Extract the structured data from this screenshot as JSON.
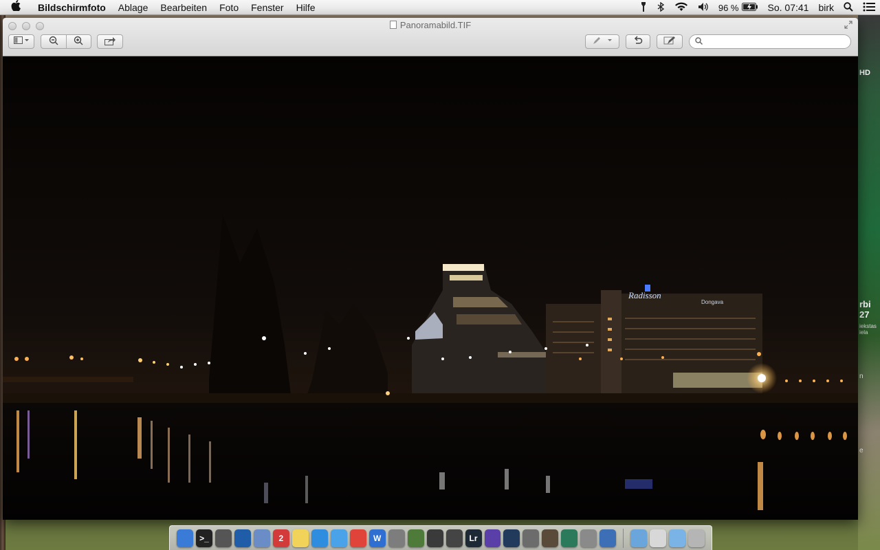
{
  "menubar": {
    "apple_icon": "apple-icon",
    "app_name": "Bildschirmfoto",
    "menus": [
      "Ablage",
      "Bearbeiten",
      "Foto",
      "Fenster",
      "Hilfe"
    ],
    "status": {
      "battery_percent": "96 %",
      "clock": "So. 07:41",
      "user": "birk"
    }
  },
  "window": {
    "title": "Panoramabild.TIF",
    "search": {
      "placeholder": "",
      "value": ""
    }
  },
  "desktop": {
    "hd_label": "HD",
    "poster_text": "rbi 27",
    "poster_sub": "iekstas iela",
    "side_n": "n",
    "side_e": "e"
  },
  "photo": {
    "hotel_sign": "Radisson",
    "building_sign": "Dongava"
  },
  "dock": {
    "items": [
      {
        "name": "finder",
        "label": "",
        "color": "#3b7bd8"
      },
      {
        "name": "terminal",
        "label": ">_",
        "color": "#222222"
      },
      {
        "name": "activity-monitor",
        "label": "",
        "color": "#555555"
      },
      {
        "name": "network",
        "label": "",
        "color": "#1f5da8"
      },
      {
        "name": "preview",
        "label": "",
        "color": "#6a8cc7"
      },
      {
        "name": "calendar",
        "label": "2",
        "color": "#d33a3a"
      },
      {
        "name": "notes",
        "label": "",
        "color": "#f2d35a"
      },
      {
        "name": "itunes",
        "label": "",
        "color": "#2f8de0"
      },
      {
        "name": "safari",
        "label": "",
        "color": "#4aa3e8"
      },
      {
        "name": "chrome",
        "label": "",
        "color": "#e0433a"
      },
      {
        "name": "word",
        "label": "W",
        "color": "#2e6fd1"
      },
      {
        "name": "camera",
        "label": "",
        "color": "#7d7d7d"
      },
      {
        "name": "photo-booth",
        "label": "",
        "color": "#4e7a3a"
      },
      {
        "name": "image-capture",
        "label": "",
        "color": "#3a3a3a"
      },
      {
        "name": "nikon",
        "label": "",
        "color": "#444444"
      },
      {
        "name": "lightroom",
        "label": "Lr",
        "color": "#1d2a36"
      },
      {
        "name": "aperture",
        "label": "",
        "color": "#5b3fa8"
      },
      {
        "name": "info",
        "label": "",
        "color": "#223a5c"
      },
      {
        "name": "screenshot-tool",
        "label": "",
        "color": "#6c6c6c"
      },
      {
        "name": "iphoto",
        "label": "",
        "color": "#5a4a3a"
      },
      {
        "name": "photo-app",
        "label": "",
        "color": "#2b7a5c"
      },
      {
        "name": "migration",
        "label": "",
        "color": "#8a8a8a"
      },
      {
        "name": "photo-viewer",
        "label": "",
        "color": "#3c6fb5"
      }
    ],
    "right_items": [
      {
        "name": "applications-folder",
        "label": "",
        "color": "#6aa6dc"
      },
      {
        "name": "home-folder",
        "label": "",
        "color": "#d8d8d8"
      },
      {
        "name": "downloads-folder",
        "label": "",
        "color": "#7ab4e6"
      },
      {
        "name": "trash",
        "label": "",
        "color": "#b5b5b5"
      }
    ]
  }
}
